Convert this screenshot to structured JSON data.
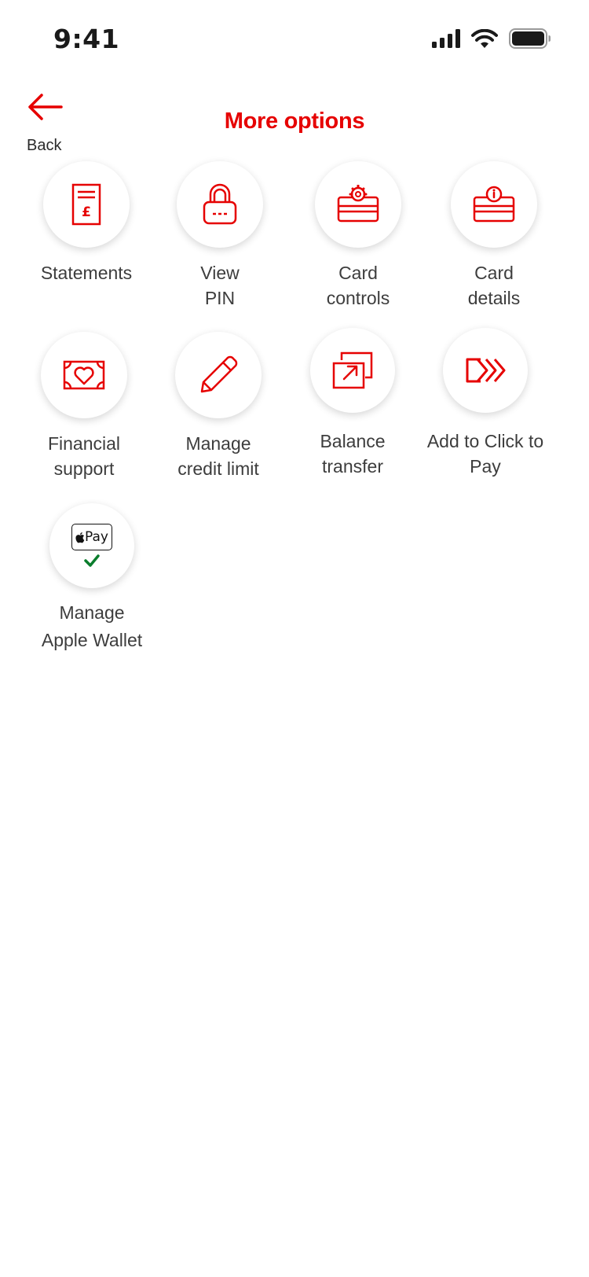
{
  "status_bar": {
    "time": "9:41",
    "icons": [
      "signal-icon",
      "wifi-icon",
      "battery-icon"
    ]
  },
  "nav": {
    "back_label": "Back",
    "back_icon": "arrow-left-icon",
    "title": "More options"
  },
  "colors": {
    "accent": "#e60000",
    "text": "#3d3d3d",
    "check": "#0a7d2c"
  },
  "options": [
    {
      "label": "Statements",
      "icon": "statement-pound-icon"
    },
    {
      "label": "View\nPIN",
      "icon": "padlock-icon"
    },
    {
      "label": "Card\ncontrols",
      "icon": "card-gear-icon"
    },
    {
      "label": "Card\ndetails",
      "icon": "card-info-icon"
    },
    {
      "label": "Financial\nsupport",
      "icon": "banknote-heart-icon"
    },
    {
      "label": "Manage\ncredit limit",
      "icon": "pencil-icon"
    },
    {
      "label": "Balance\ntransfer",
      "icon": "transfer-arrow-icon"
    },
    {
      "label": "Add to Click to\nPay",
      "icon": "click-to-pay-icon"
    },
    {
      "label": "Manage\nApple Wallet",
      "icon": "apple-pay-icon",
      "badge": "Pay"
    }
  ]
}
